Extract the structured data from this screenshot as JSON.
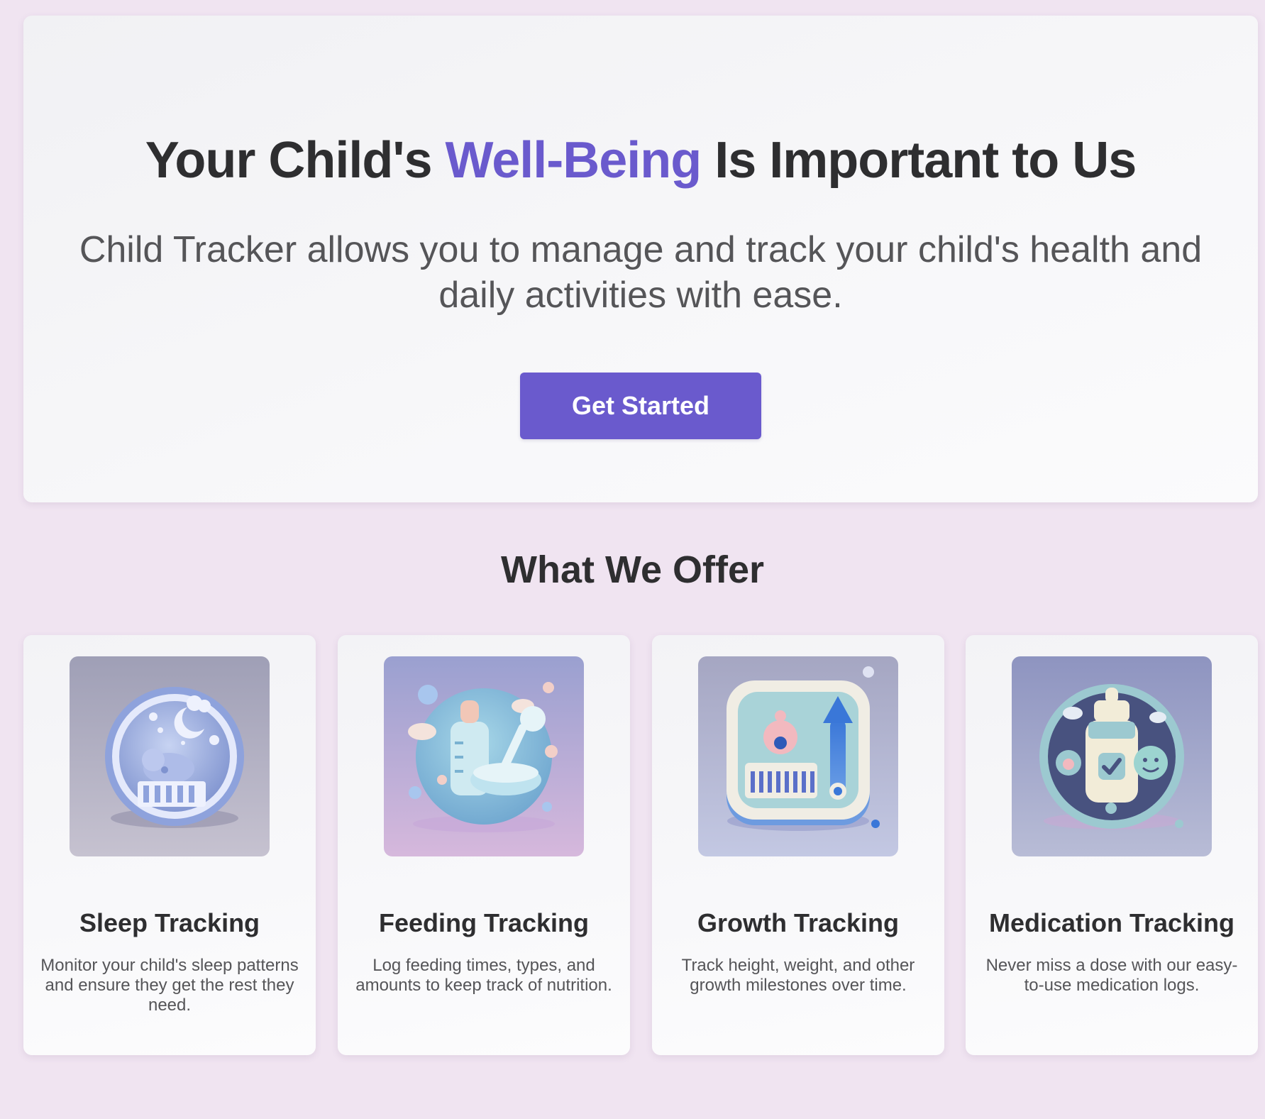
{
  "colors": {
    "page_background": "#f0e4f1",
    "accent": "#6a5acd",
    "heading": "#2e2e30",
    "body_text": "#555558"
  },
  "hero": {
    "title_before": "Your Child's ",
    "title_accent": "Well-Being",
    "title_after": " Is Important to Us",
    "subtitle": "Child Tracker allows you to manage and track your child's health and daily activities with ease.",
    "cta_label": "Get Started"
  },
  "features": {
    "heading": "What We Offer",
    "cards": [
      {
        "title": "Sleep Tracking",
        "description": "Monitor your child's sleep patterns and ensure they get the rest they need.",
        "icon": "sleep-tracking-icon"
      },
      {
        "title": "Feeding Tracking",
        "description": "Log feeding times, types, and amounts to keep track of nutrition.",
        "icon": "feeding-tracking-icon"
      },
      {
        "title": "Growth Tracking",
        "description": "Track height, weight, and other growth milestones over time.",
        "icon": "growth-tracking-icon"
      },
      {
        "title": "Medication Tracking",
        "description": "Never miss a dose with our easy-to-use medication logs.",
        "icon": "medication-tracking-icon"
      }
    ]
  }
}
